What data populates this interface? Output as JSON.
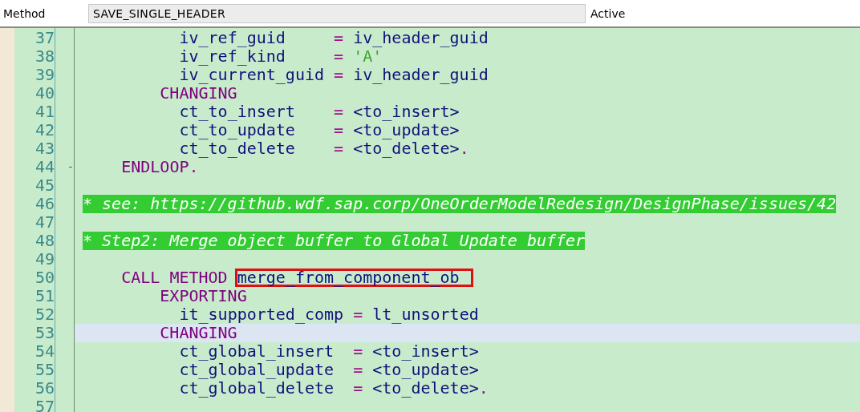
{
  "header": {
    "label": "Method",
    "value": "SAVE_SINGLE_HEADER",
    "status": "Active"
  },
  "lines": [
    {
      "number": "37",
      "current": false,
      "fold_end": false,
      "tokens": [
        {
          "kind": "id",
          "text": "          iv_ref_guid     "
        },
        {
          "kind": "op",
          "text": "= "
        },
        {
          "kind": "id",
          "text": "iv_header_guid"
        }
      ]
    },
    {
      "number": "38",
      "current": false,
      "fold_end": false,
      "tokens": [
        {
          "kind": "id",
          "text": "          iv_ref_kind     "
        },
        {
          "kind": "op",
          "text": "= "
        },
        {
          "kind": "str",
          "text": "'A'"
        }
      ]
    },
    {
      "number": "39",
      "current": false,
      "fold_end": false,
      "tokens": [
        {
          "kind": "id",
          "text": "          iv_current_guid "
        },
        {
          "kind": "op",
          "text": "= "
        },
        {
          "kind": "id",
          "text": "iv_header_guid"
        }
      ]
    },
    {
      "number": "40",
      "current": false,
      "fold_end": false,
      "tokens": [
        {
          "kind": "kw",
          "text": "        CHANGING"
        }
      ]
    },
    {
      "number": "41",
      "current": false,
      "fold_end": false,
      "tokens": [
        {
          "kind": "id",
          "text": "          ct_to_insert    "
        },
        {
          "kind": "op",
          "text": "= "
        },
        {
          "kind": "id",
          "text": "<to_insert>"
        }
      ]
    },
    {
      "number": "42",
      "current": false,
      "fold_end": false,
      "tokens": [
        {
          "kind": "id",
          "text": "          ct_to_update    "
        },
        {
          "kind": "op",
          "text": "= "
        },
        {
          "kind": "id",
          "text": "<to_update>"
        }
      ]
    },
    {
      "number": "43",
      "current": false,
      "fold_end": false,
      "tokens": [
        {
          "kind": "id",
          "text": "          ct_to_delete    "
        },
        {
          "kind": "op",
          "text": "= "
        },
        {
          "kind": "id",
          "text": "<to_delete>"
        },
        {
          "kind": "op",
          "text": "."
        }
      ]
    },
    {
      "number": "44",
      "current": false,
      "fold_end": true,
      "tokens": [
        {
          "kind": "kw",
          "text": "    ENDLOOP"
        },
        {
          "kind": "op",
          "text": "."
        }
      ]
    },
    {
      "number": "45",
      "current": false,
      "fold_end": false
    },
    {
      "number": "46",
      "current": false,
      "fold_end": false,
      "tokens": [
        {
          "kind": "comment",
          "text": "* see: https://github.wdf.sap.corp/OneOrderModelRedesign/DesignPhase/issues/42"
        }
      ]
    },
    {
      "number": "47",
      "current": false,
      "fold_end": false
    },
    {
      "number": "48",
      "current": false,
      "fold_end": false,
      "tokens": [
        {
          "kind": "comment",
          "text": "* Step2: Merge object buffer to Global Update buffer"
        }
      ]
    },
    {
      "number": "49",
      "current": false,
      "fold_end": false
    },
    {
      "number": "50",
      "current": false,
      "fold_end": false,
      "tokens": [
        {
          "kind": "kw",
          "text": "    CALL METHOD "
        },
        {
          "kind": "id",
          "text": "merge_from_component_ob",
          "marked": true
        }
      ]
    },
    {
      "number": "51",
      "current": false,
      "fold_end": false,
      "tokens": [
        {
          "kind": "kw",
          "text": "        EXPORTING"
        }
      ]
    },
    {
      "number": "52",
      "current": false,
      "fold_end": false,
      "tokens": [
        {
          "kind": "id",
          "text": "          it_supported_comp "
        },
        {
          "kind": "op",
          "text": "= "
        },
        {
          "kind": "id",
          "text": "lt_unsorted"
        }
      ]
    },
    {
      "number": "53",
      "current": true,
      "fold_end": false,
      "tokens": [
        {
          "kind": "kw",
          "text": "        CHANGING"
        }
      ]
    },
    {
      "number": "54",
      "current": false,
      "fold_end": false,
      "tokens": [
        {
          "kind": "id",
          "text": "          ct_global_insert  "
        },
        {
          "kind": "op",
          "text": "= "
        },
        {
          "kind": "id",
          "text": "<to_insert>"
        }
      ]
    },
    {
      "number": "55",
      "current": false,
      "fold_end": false,
      "tokens": [
        {
          "kind": "id",
          "text": "          ct_global_update  "
        },
        {
          "kind": "op",
          "text": "= "
        },
        {
          "kind": "id",
          "text": "<to_update>"
        }
      ]
    },
    {
      "number": "56",
      "current": false,
      "fold_end": false,
      "tokens": [
        {
          "kind": "id",
          "text": "          ct_global_delete  "
        },
        {
          "kind": "op",
          "text": "= "
        },
        {
          "kind": "id",
          "text": "<to_delete>"
        },
        {
          "kind": "op",
          "text": "."
        }
      ]
    },
    {
      "number": "57",
      "current": false,
      "fold_end": false
    }
  ]
}
